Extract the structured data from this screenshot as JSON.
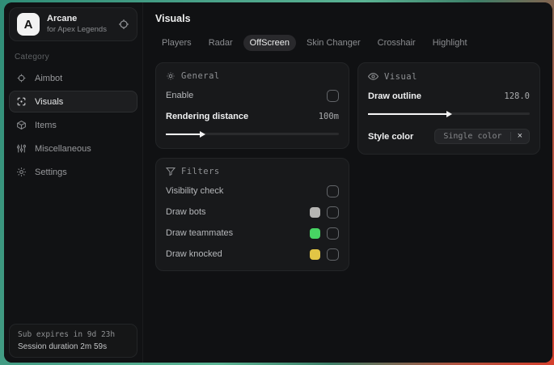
{
  "sidebar": {
    "logo": {
      "avatar_letter": "A",
      "title": "Arcane",
      "subtitle": "for Apex Legends"
    },
    "category_label": "Category",
    "items": [
      {
        "label": "Aimbot",
        "icon": "crosshair-icon",
        "selected": false
      },
      {
        "label": "Visuals",
        "icon": "scan-icon",
        "selected": true
      },
      {
        "label": "Items",
        "icon": "box-icon",
        "selected": false
      },
      {
        "label": "Miscellaneous",
        "icon": "sliders-icon",
        "selected": false
      },
      {
        "label": "Settings",
        "icon": "gear-icon",
        "selected": false
      }
    ],
    "footer": {
      "sub_expires": "Sub expires in 9d 23h",
      "session_duration": "Session duration 2m 59s"
    }
  },
  "main": {
    "title": "Visuals",
    "tabs": [
      {
        "label": "Players",
        "selected": false
      },
      {
        "label": "Radar",
        "selected": false
      },
      {
        "label": "OffScreen",
        "selected": true
      },
      {
        "label": "Skin Changer",
        "selected": false
      },
      {
        "label": "Crosshair",
        "selected": false
      },
      {
        "label": "Highlight",
        "selected": false
      }
    ],
    "general": {
      "header": "General",
      "enable_label": "Enable",
      "enable_checked": false,
      "distance_label": "Rendering distance",
      "distance_value": "100m",
      "distance_percent": 20
    },
    "filters": {
      "header": "Filters",
      "rows": [
        {
          "label": "Visibility check",
          "swatch": null,
          "checked": false
        },
        {
          "label": "Draw bots",
          "swatch": "#b5b5b3",
          "checked": false
        },
        {
          "label": "Draw teammates",
          "swatch": "#47d463",
          "checked": false
        },
        {
          "label": "Draw knocked",
          "swatch": "#e2c545",
          "checked": false
        }
      ]
    },
    "visual": {
      "header": "Visual",
      "outline_label": "Draw outline",
      "outline_value": "128.0",
      "outline_percent": 49,
      "style_label": "Style color",
      "style_chip": "Single color",
      "chip_close": "×"
    }
  },
  "colors": {
    "accent_teal_bg": "#4aa289",
    "accent_red_bg": "#d43f2c",
    "slider_fill": "#f4f4f5"
  }
}
